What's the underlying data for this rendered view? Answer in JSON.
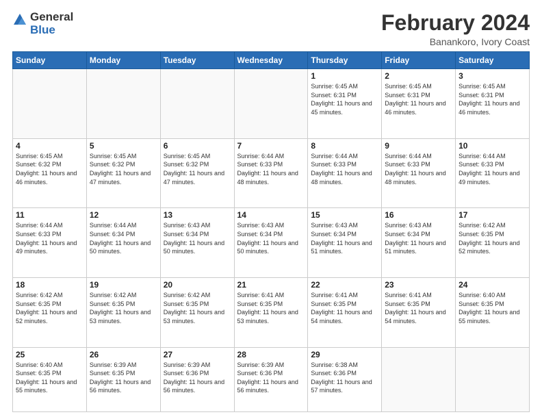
{
  "logo": {
    "general": "General",
    "blue": "Blue"
  },
  "header": {
    "title": "February 2024",
    "subtitle": "Banankoro, Ivory Coast"
  },
  "weekdays": [
    "Sunday",
    "Monday",
    "Tuesday",
    "Wednesday",
    "Thursday",
    "Friday",
    "Saturday"
  ],
  "weeks": [
    [
      {
        "day": "",
        "info": ""
      },
      {
        "day": "",
        "info": ""
      },
      {
        "day": "",
        "info": ""
      },
      {
        "day": "",
        "info": ""
      },
      {
        "day": "1",
        "info": "Sunrise: 6:45 AM\nSunset: 6:31 PM\nDaylight: 11 hours and 45 minutes."
      },
      {
        "day": "2",
        "info": "Sunrise: 6:45 AM\nSunset: 6:31 PM\nDaylight: 11 hours and 46 minutes."
      },
      {
        "day": "3",
        "info": "Sunrise: 6:45 AM\nSunset: 6:31 PM\nDaylight: 11 hours and 46 minutes."
      }
    ],
    [
      {
        "day": "4",
        "info": "Sunrise: 6:45 AM\nSunset: 6:32 PM\nDaylight: 11 hours and 46 minutes."
      },
      {
        "day": "5",
        "info": "Sunrise: 6:45 AM\nSunset: 6:32 PM\nDaylight: 11 hours and 47 minutes."
      },
      {
        "day": "6",
        "info": "Sunrise: 6:45 AM\nSunset: 6:32 PM\nDaylight: 11 hours and 47 minutes."
      },
      {
        "day": "7",
        "info": "Sunrise: 6:44 AM\nSunset: 6:33 PM\nDaylight: 11 hours and 48 minutes."
      },
      {
        "day": "8",
        "info": "Sunrise: 6:44 AM\nSunset: 6:33 PM\nDaylight: 11 hours and 48 minutes."
      },
      {
        "day": "9",
        "info": "Sunrise: 6:44 AM\nSunset: 6:33 PM\nDaylight: 11 hours and 48 minutes."
      },
      {
        "day": "10",
        "info": "Sunrise: 6:44 AM\nSunset: 6:33 PM\nDaylight: 11 hours and 49 minutes."
      }
    ],
    [
      {
        "day": "11",
        "info": "Sunrise: 6:44 AM\nSunset: 6:33 PM\nDaylight: 11 hours and 49 minutes."
      },
      {
        "day": "12",
        "info": "Sunrise: 6:44 AM\nSunset: 6:34 PM\nDaylight: 11 hours and 50 minutes."
      },
      {
        "day": "13",
        "info": "Sunrise: 6:43 AM\nSunset: 6:34 PM\nDaylight: 11 hours and 50 minutes."
      },
      {
        "day": "14",
        "info": "Sunrise: 6:43 AM\nSunset: 6:34 PM\nDaylight: 11 hours and 50 minutes."
      },
      {
        "day": "15",
        "info": "Sunrise: 6:43 AM\nSunset: 6:34 PM\nDaylight: 11 hours and 51 minutes."
      },
      {
        "day": "16",
        "info": "Sunrise: 6:43 AM\nSunset: 6:34 PM\nDaylight: 11 hours and 51 minutes."
      },
      {
        "day": "17",
        "info": "Sunrise: 6:42 AM\nSunset: 6:35 PM\nDaylight: 11 hours and 52 minutes."
      }
    ],
    [
      {
        "day": "18",
        "info": "Sunrise: 6:42 AM\nSunset: 6:35 PM\nDaylight: 11 hours and 52 minutes."
      },
      {
        "day": "19",
        "info": "Sunrise: 6:42 AM\nSunset: 6:35 PM\nDaylight: 11 hours and 53 minutes."
      },
      {
        "day": "20",
        "info": "Sunrise: 6:42 AM\nSunset: 6:35 PM\nDaylight: 11 hours and 53 minutes."
      },
      {
        "day": "21",
        "info": "Sunrise: 6:41 AM\nSunset: 6:35 PM\nDaylight: 11 hours and 53 minutes."
      },
      {
        "day": "22",
        "info": "Sunrise: 6:41 AM\nSunset: 6:35 PM\nDaylight: 11 hours and 54 minutes."
      },
      {
        "day": "23",
        "info": "Sunrise: 6:41 AM\nSunset: 6:35 PM\nDaylight: 11 hours and 54 minutes."
      },
      {
        "day": "24",
        "info": "Sunrise: 6:40 AM\nSunset: 6:35 PM\nDaylight: 11 hours and 55 minutes."
      }
    ],
    [
      {
        "day": "25",
        "info": "Sunrise: 6:40 AM\nSunset: 6:35 PM\nDaylight: 11 hours and 55 minutes."
      },
      {
        "day": "26",
        "info": "Sunrise: 6:39 AM\nSunset: 6:35 PM\nDaylight: 11 hours and 56 minutes."
      },
      {
        "day": "27",
        "info": "Sunrise: 6:39 AM\nSunset: 6:36 PM\nDaylight: 11 hours and 56 minutes."
      },
      {
        "day": "28",
        "info": "Sunrise: 6:39 AM\nSunset: 6:36 PM\nDaylight: 11 hours and 56 minutes."
      },
      {
        "day": "29",
        "info": "Sunrise: 6:38 AM\nSunset: 6:36 PM\nDaylight: 11 hours and 57 minutes."
      },
      {
        "day": "",
        "info": ""
      },
      {
        "day": "",
        "info": ""
      }
    ]
  ]
}
